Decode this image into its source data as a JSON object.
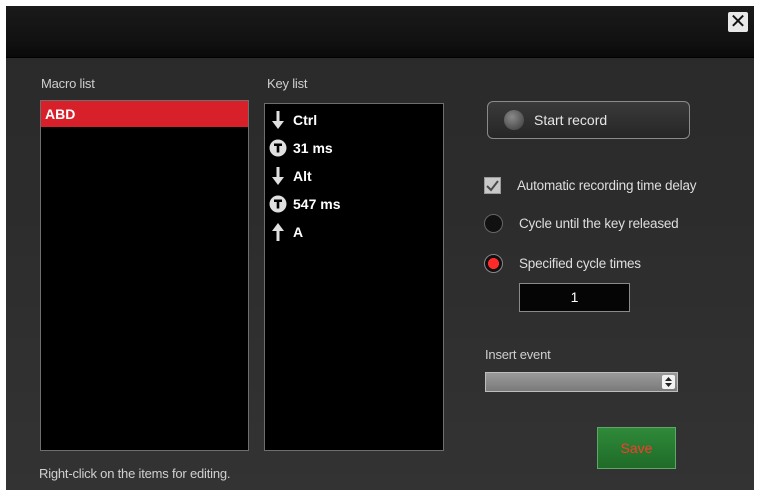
{
  "window": {
    "close_glyph": "✕"
  },
  "macro_list": {
    "label": "Macro list",
    "items": [
      "ABD"
    ]
  },
  "key_list": {
    "label": "Key list",
    "items": [
      {
        "icon": "arrow-down-icon",
        "text": "Ctrl"
      },
      {
        "icon": "timer-icon",
        "text": "31 ms"
      },
      {
        "icon": "arrow-down-icon",
        "text": "Alt"
      },
      {
        "icon": "timer-icon",
        "text": "547 ms"
      },
      {
        "icon": "arrow-up-icon",
        "text": "A"
      }
    ]
  },
  "record": {
    "label": "Start record"
  },
  "options": {
    "auto_delay": {
      "label": "Automatic recording time delay",
      "checked": true
    },
    "cycle_until_release": {
      "label": "Cycle until the key released",
      "selected": false
    },
    "specified_cycles": {
      "label": "Specified cycle times",
      "selected": true,
      "value": "1"
    }
  },
  "insert_event": {
    "label": "Insert event",
    "value": ""
  },
  "save": {
    "label": "Save"
  },
  "hint": "Right-click on the items for editing.",
  "colors": {
    "accent_red": "#d8202a",
    "save_green": "#2a7f34",
    "save_text": "#ff3a2a"
  }
}
